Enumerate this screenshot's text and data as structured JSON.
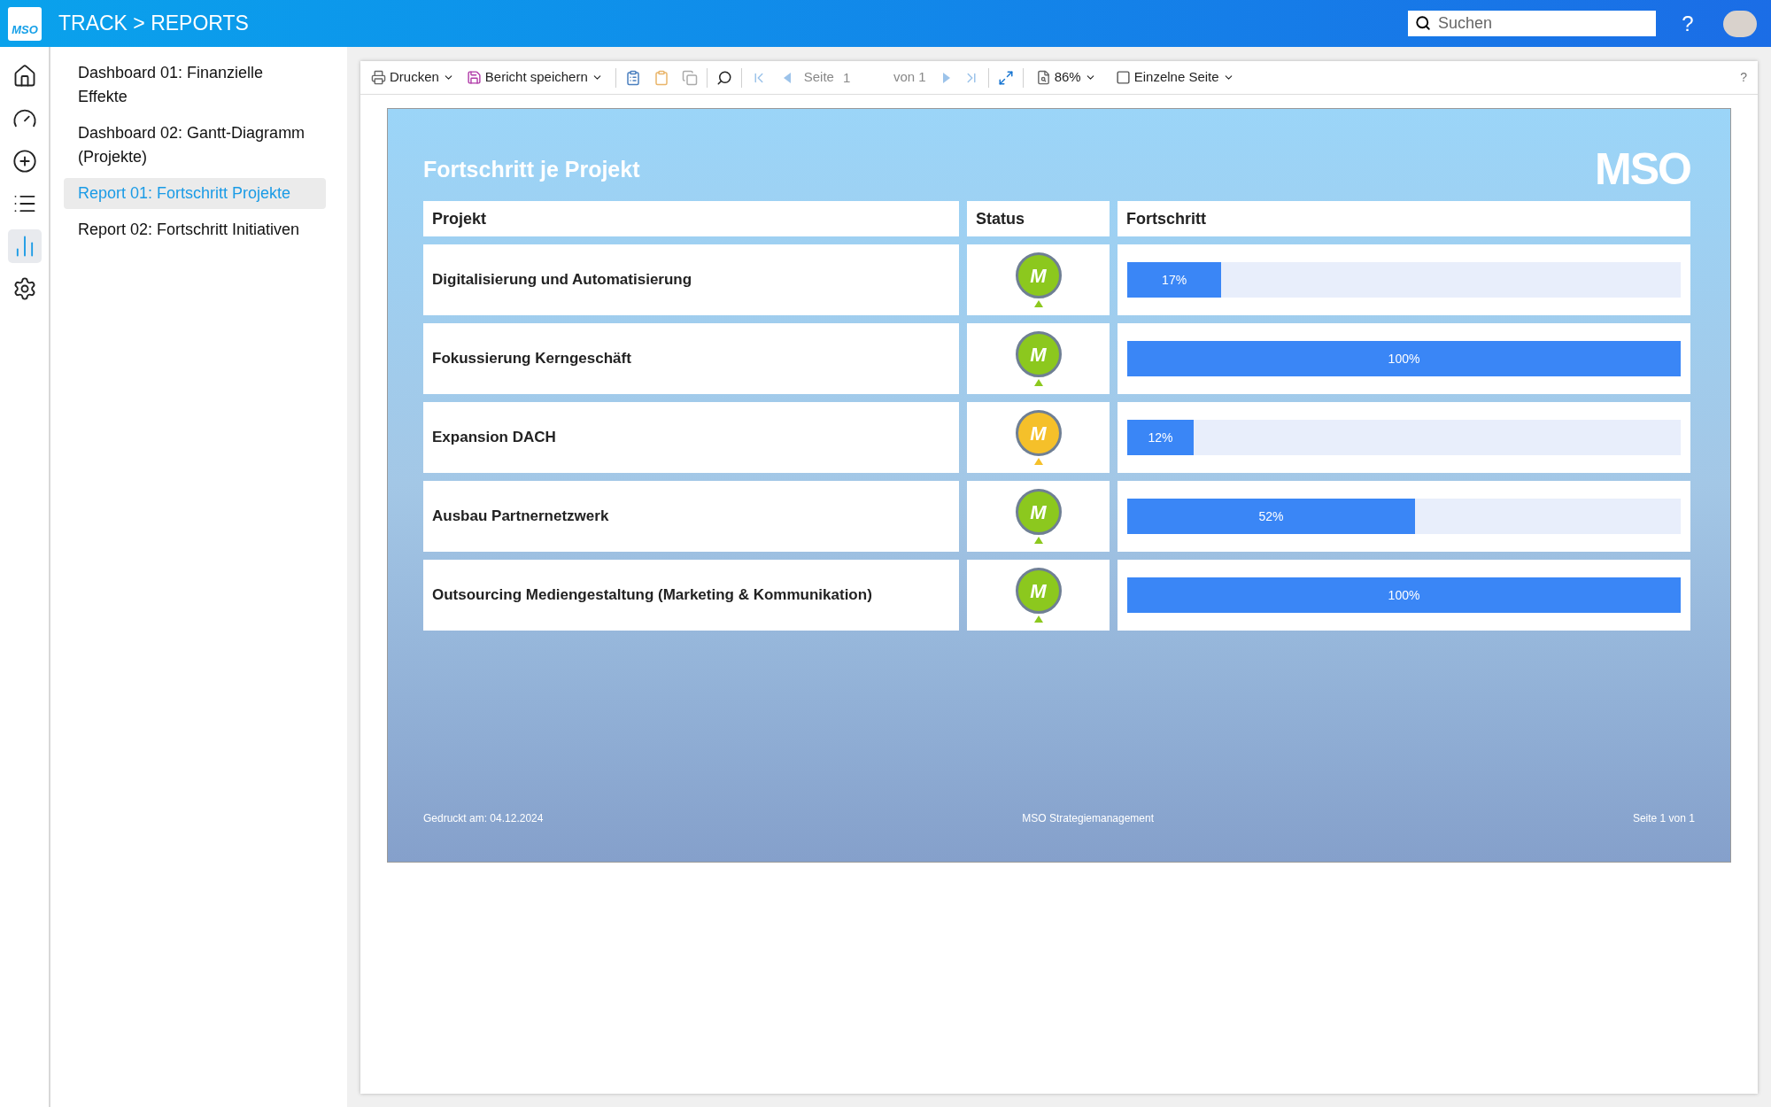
{
  "header": {
    "logo": "MSO",
    "breadcrumb": "TRACK > REPORTS",
    "search": {
      "placeholder": "Suchen"
    },
    "help": "?"
  },
  "rail": [
    {
      "kind": "home",
      "selected": false
    },
    {
      "kind": "gauge",
      "selected": false
    },
    {
      "kind": "add",
      "selected": false
    },
    {
      "kind": "list",
      "selected": false
    },
    {
      "kind": "chart",
      "selected": true
    },
    {
      "kind": "settings",
      "selected": false
    }
  ],
  "nav": [
    {
      "label": "Dashboard 01: Finanzielle Effekte",
      "selected": false
    },
    {
      "label": "Dashboard 02: Gantt-Diagramm (Projekte)",
      "selected": false
    },
    {
      "label": "Report 01: Fortschritt Projekte",
      "selected": true
    },
    {
      "label": "Report 02: Fortschritt Initiativen",
      "selected": false
    }
  ],
  "toolbar": {
    "print": "Drucken",
    "save": "Bericht speichern",
    "page_label": "Seite",
    "page_value": "1",
    "page_total": "von 1",
    "zoom": "86%",
    "view_mode": "Einzelne Seite",
    "help": "?"
  },
  "report": {
    "title": "Fortschritt je Projekt",
    "logo": "MSO",
    "columns": [
      "Projekt",
      "Status",
      "Fortschritt"
    ],
    "rows": [
      {
        "project": "Digitalisierung und Automatisierung",
        "status_mark": "M",
        "color": "#8cc81e",
        "level": 0.17,
        "reading": "17%"
      },
      {
        "project": "Fokussierung Kerngeschäft",
        "status_mark": "M",
        "color": "#8cc81e",
        "level": 1,
        "reading": "100%"
      },
      {
        "project": "Expansion DACH",
        "status_mark": "M",
        "color": "#f5c02a",
        "level": 0.12,
        "reading": "12%"
      },
      {
        "project": "Ausbau Partnernetzwerk",
        "status_mark": "M",
        "color": "#8cc81e",
        "level": 0.52,
        "reading": "52%"
      },
      {
        "project": "Outsourcing Mediengestaltung (Marketing & Kommunikation)",
        "status_mark": "M",
        "color": "#8cc81e",
        "level": 1,
        "reading": "100%"
      }
    ],
    "footer": {
      "printed": "Gedruckt am: 04.12.2024",
      "company": "MSO Strategiemanagement",
      "page": "Seite 1 von 1"
    }
  }
}
